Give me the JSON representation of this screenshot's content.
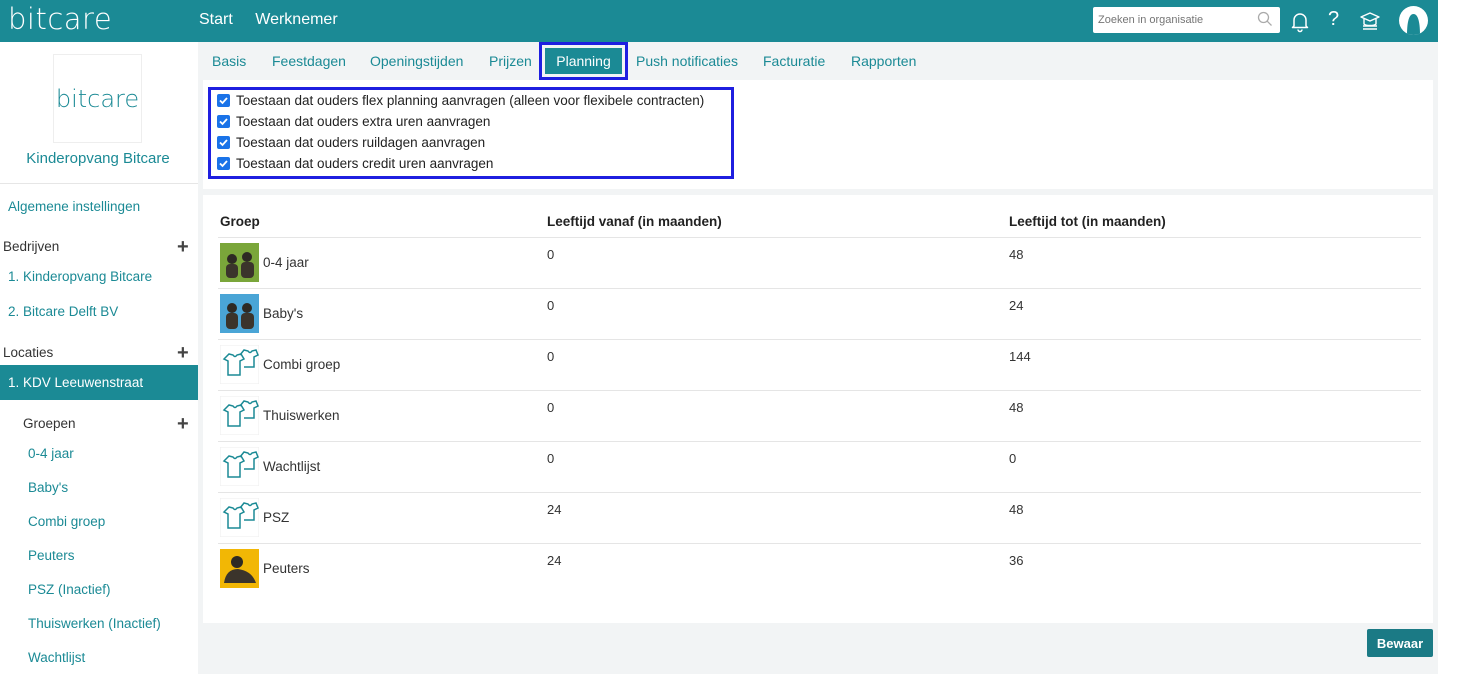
{
  "app": {
    "logo": "bitcare"
  },
  "topnav": {
    "start": "Start",
    "werknemer": "Werknemer"
  },
  "search": {
    "placeholder": "Zoeken in organisatie"
  },
  "help_label": "?",
  "sidebar": {
    "org_logo": "bitcare",
    "org_name": "Kinderopvang Bitcare",
    "general": "Algemene instellingen",
    "bedrijven_label": "Bedrijven",
    "bedrijven": [
      "1. Kinderopvang Bitcare",
      "2. Bitcare Delft BV"
    ],
    "locaties_label": "Locaties",
    "active_location": "1. KDV Leeuwenstraat",
    "groepen_label": "Groepen",
    "groepen": [
      "0-4 jaar",
      "Baby's",
      "Combi groep",
      "Peuters",
      "PSZ (Inactief)",
      "Thuiswerken (Inactief)",
      "Wachtlijst"
    ]
  },
  "tabs": [
    "Basis",
    "Feestdagen",
    "Openingstijden",
    "Prijzen",
    "Planning",
    "Push notificaties",
    "Facturatie",
    "Rapporten"
  ],
  "settings": {
    "options": [
      "Toestaan dat ouders flex planning aanvragen (alleen voor flexibele contracten)",
      "Toestaan dat ouders extra uren aanvragen",
      "Toestaan dat ouders ruildagen aanvragen",
      "Toestaan dat ouders credit uren aanvragen"
    ]
  },
  "table": {
    "headers": [
      "Groep",
      "Leeftijd vanaf (in maanden)",
      "Leeftijd tot (in maanden)"
    ],
    "rows": [
      {
        "name": "0-4 jaar",
        "from": "0",
        "to": "48",
        "icon": "photo-children-green"
      },
      {
        "name": "Baby's",
        "from": "0",
        "to": "24",
        "icon": "photo-children-blue"
      },
      {
        "name": "Combi groep",
        "from": "0",
        "to": "144",
        "icon": "onesie-icon"
      },
      {
        "name": "Thuiswerken",
        "from": "0",
        "to": "48",
        "icon": "onesie-icon"
      },
      {
        "name": "Wachtlijst",
        "from": "0",
        "to": "0",
        "icon": "onesie-icon"
      },
      {
        "name": "PSZ",
        "from": "24",
        "to": "48",
        "icon": "onesie-icon"
      },
      {
        "name": "Peuters",
        "from": "24",
        "to": "36",
        "icon": "photo-child-yellow"
      }
    ]
  },
  "save_label": "Bewaar",
  "colors": {
    "brand": "#1b8a95",
    "highlight": "#1f1fe0",
    "checkbox": "#1a73e8"
  }
}
